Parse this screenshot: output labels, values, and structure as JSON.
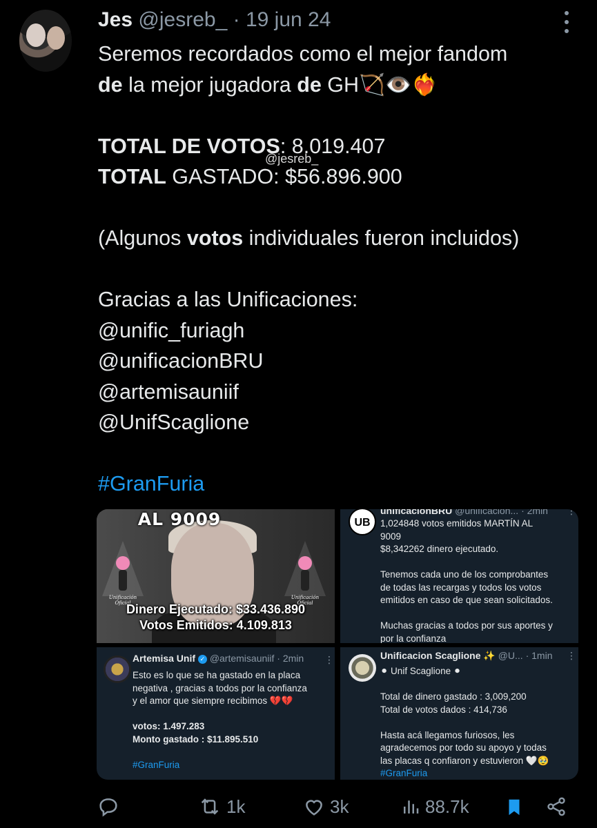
{
  "author": {
    "name": "Jes",
    "handle": "@jesreb_",
    "separator": "·",
    "date": "19 jun 24"
  },
  "tweet": {
    "line1": "Seremos recordados como el mejor fandom",
    "line2_bold1": "de",
    "line2_mid": " la mejor jugadora ",
    "line2_bold2": "de",
    "line2_end": " GH🏹👁️❤️‍🔥",
    "total_votes_label": "TOTAL DE VOTOS",
    "total_votes_value": ": 8.019.407",
    "total_spent_label": "TOTAL",
    "total_spent_value": " GASTADO: $56.896.900",
    "note_start": "(Algunos ",
    "note_bold": "votos",
    "note_end": " individuales fueron incluidos)",
    "thanks": "Gracias a las Unificaciones:",
    "mentions": [
      "@unific_furiagh",
      "@unificacionBRU",
      "@artemisauniif",
      "@UnifScaglione"
    ],
    "hashtag": "#GranFuria"
  },
  "watermark": "@jesreb_",
  "media": {
    "tile1": {
      "headline": "AL 9009",
      "figure_label": "Unificación Oficial",
      "caption1": "Dinero Ejecutado: $33.436.890",
      "caption2": "Votos Emitidos: 4.109.813"
    },
    "tile2": {
      "avatar_text": "UB",
      "name": "unificacionBRU",
      "handle": "@unificacion...",
      "time": "· 2min",
      "lines": [
        "1,024848 votos emitidos MARTÍN AL",
        "9009",
        "$8,342262 dinero ejecutado.",
        "",
        "Tenemos cada uno de los comprobantes",
        "de todas las recargas y todos los votos",
        "emitidos en caso de que sean solicitados.",
        "",
        "Muchas gracias a todos por sus aportes y",
        "por la confianza"
      ]
    },
    "tile3": {
      "name": "Artemisa Unif",
      "handle": "@artemisauniif",
      "time": "· 2min",
      "lines": [
        "Esto es lo que se ha gastado en la placa",
        "negativa , gracias a todos por la confianza",
        "y el amor que siempre recibimos 💔💔",
        "",
        "votos: 1.497.283",
        "Monto gastado : $11.895.510",
        "",
        "#GranFuria"
      ]
    },
    "tile4": {
      "name": "Unificacion Scaglione ✨",
      "handle": "@U...",
      "time": "· 1min",
      "lines": [
        "⚫ Unif Scaglione ⚫",
        "",
        "Total de dinero gastado : 3,009,200",
        "Total de votos dados : 414,736",
        "",
        "Hasta acá llegamos furiosos, les",
        "agradecemos por todo su apoyo y todas",
        "las placas q confiaron y estuvieron 🤍🥹",
        "#GranFuria"
      ]
    }
  },
  "actions": {
    "reply_icon": "reply-icon",
    "retweets": "1k",
    "likes": "3k",
    "views": "88.7k",
    "bookmark_color": "#1d9bf0",
    "muted_color": "#8b98a5"
  }
}
